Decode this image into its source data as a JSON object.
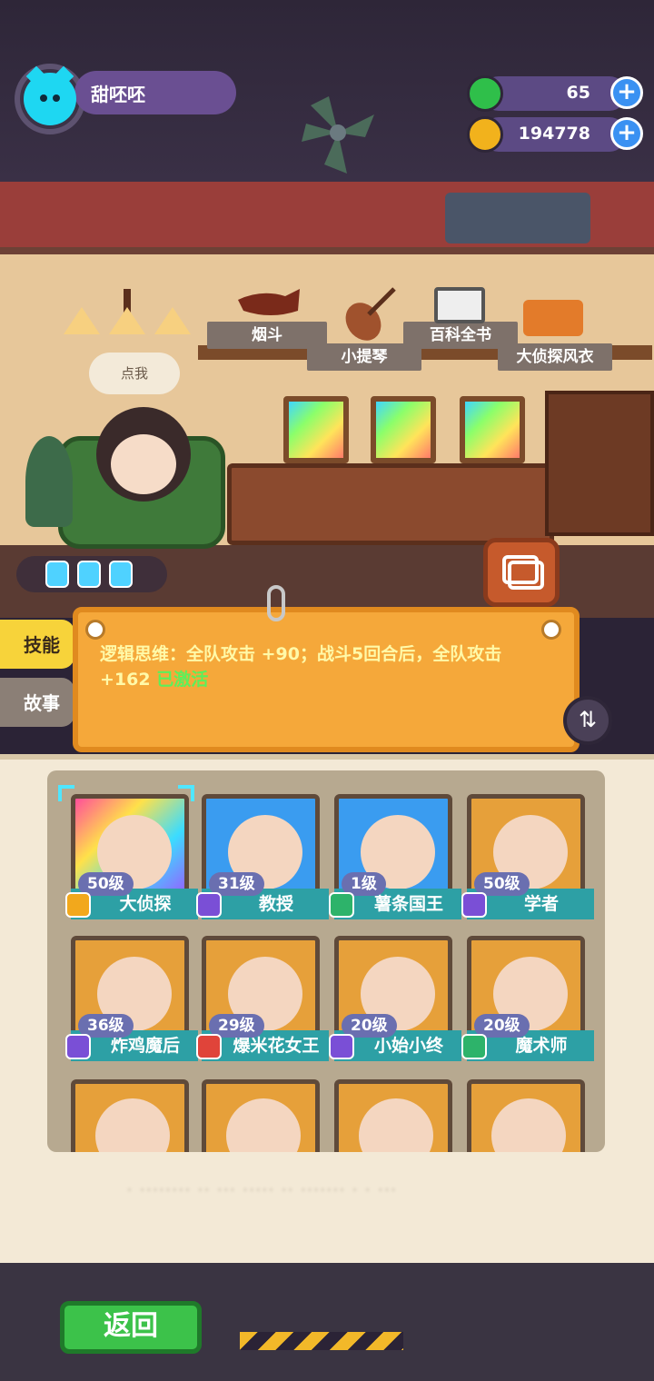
{
  "player": {
    "name": "甜呸呸"
  },
  "resources": {
    "gems": "65",
    "coins": "194778"
  },
  "scene": {
    "speech_bubble": "点我",
    "shelf_items": [
      "烟斗",
      "小提琴",
      "百科全书",
      "大侦探风衣"
    ]
  },
  "side_tabs": {
    "skills": "技能",
    "story": "故事"
  },
  "skill_text": {
    "main": "逻辑思维：全队攻击 +90；战斗5回合后，全队攻击 +162 ",
    "status": "已激活"
  },
  "characters": [
    {
      "level": "50级",
      "name": "大侦探",
      "badge_color": "#f2a81c",
      "frame": "rainbow",
      "selected": true
    },
    {
      "level": "31级",
      "name": "教授",
      "badge_color": "#7a4fd6",
      "frame": "blue"
    },
    {
      "level": "1级",
      "name": "薯条国王",
      "badge_color": "#2db36a",
      "frame": "blue"
    },
    {
      "level": "50级",
      "name": "学者",
      "badge_color": "#7a4fd6",
      "frame": "gold"
    },
    {
      "level": "36级",
      "name": "炸鸡魔后",
      "badge_color": "#7a4fd6",
      "frame": "gold"
    },
    {
      "level": "29级",
      "name": "爆米花女王",
      "badge_color": "#e0443a",
      "frame": "gold"
    },
    {
      "level": "20级",
      "name": "小始小终",
      "badge_color": "#7a4fd6",
      "frame": "gold"
    },
    {
      "level": "20级",
      "name": "魔术师",
      "badge_color": "#2db36a",
      "frame": "gold"
    }
  ],
  "partial_row_count": 4,
  "back_button": "返回",
  "colors": {
    "accent_orange": "#f5a83a",
    "back_green": "#3cc24a",
    "plus_blue": "#3a91f2"
  }
}
